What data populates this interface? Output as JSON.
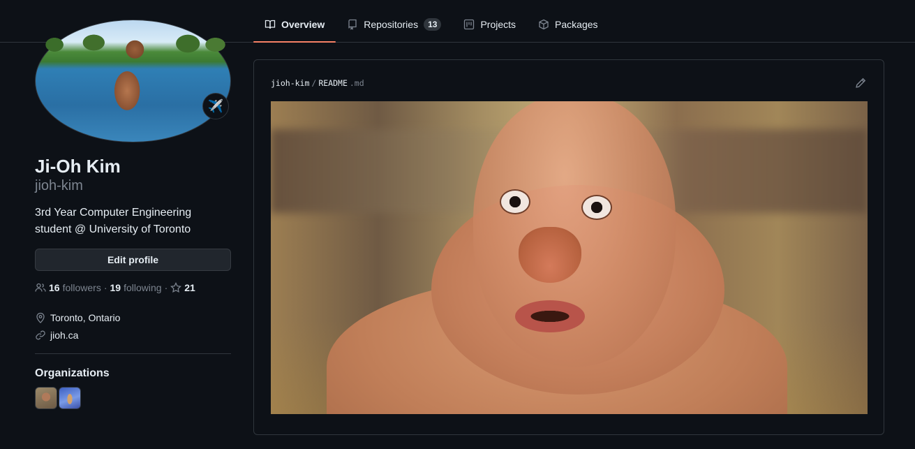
{
  "tabs": [
    {
      "label": "Overview",
      "icon": "book-icon",
      "selected": true
    },
    {
      "label": "Repositories",
      "icon": "repo-icon",
      "count": "13"
    },
    {
      "label": "Projects",
      "icon": "project-icon"
    },
    {
      "label": "Packages",
      "icon": "package-icon"
    }
  ],
  "profile": {
    "fullname": "Ji-Oh Kim",
    "username": "jioh-kim",
    "status_emoji": "✈️",
    "bio": "3rd Year Computer Engineering student @ University of Toronto",
    "edit_label": "Edit profile",
    "followers_count": "16",
    "followers_label": "followers",
    "following_count": "19",
    "following_label": "following",
    "stars_count": "21",
    "separator": "·",
    "location": "Toronto, Ontario",
    "website": "jioh.ca"
  },
  "organizations": {
    "title": "Organizations"
  },
  "readme": {
    "owner": "jioh-kim",
    "slash": "/",
    "filename": "README",
    "extension": ".md"
  },
  "colors": {
    "background": "#0d1117",
    "border": "#30363d",
    "accent_underline": "#f78166",
    "muted_text": "#7d8590"
  }
}
